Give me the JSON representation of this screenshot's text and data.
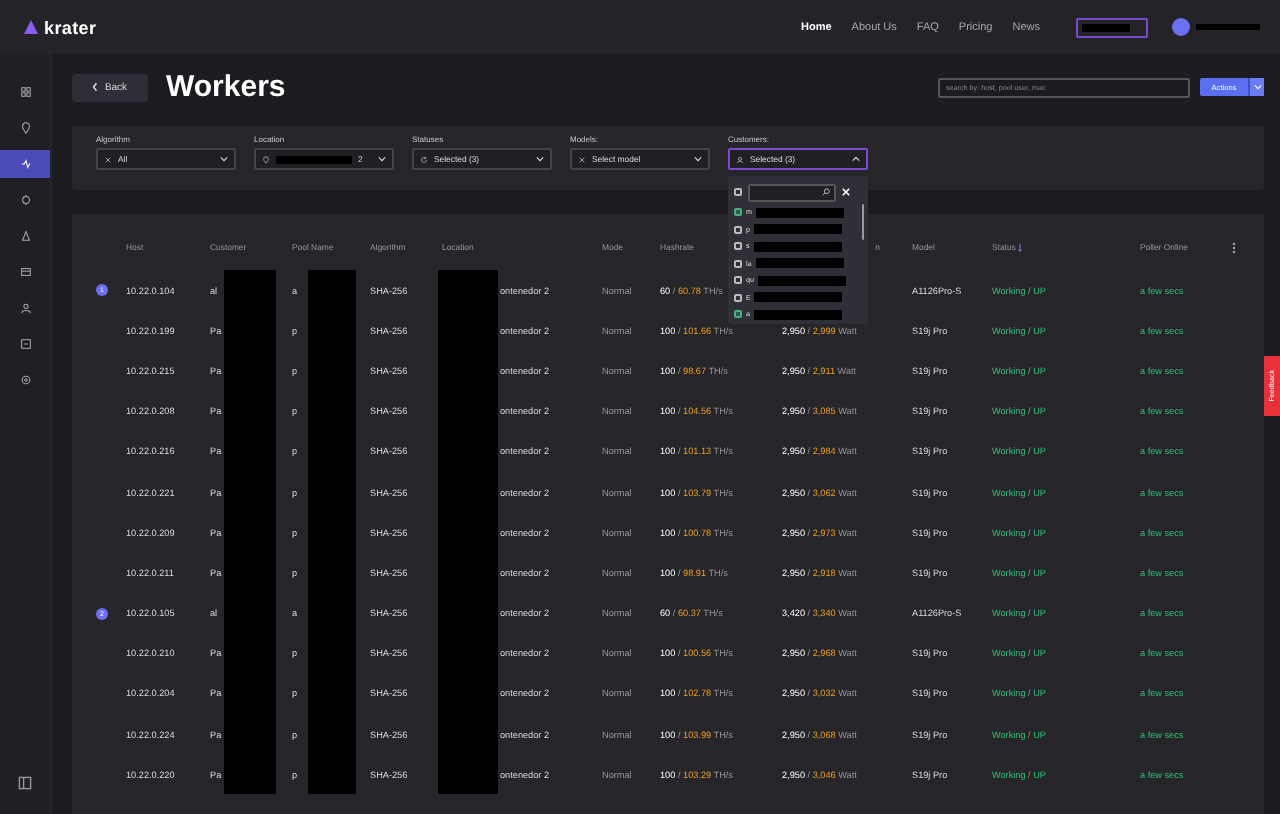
{
  "brand": {
    "name": "krater"
  },
  "nav": {
    "links": [
      {
        "label": "Home",
        "selected": true
      },
      {
        "label": "About Us",
        "selected": false
      },
      {
        "label": "FAQ",
        "selected": false
      },
      {
        "label": "Pricing",
        "selected": false
      },
      {
        "label": "News",
        "selected": false
      }
    ]
  },
  "sidebar": {
    "items": [
      {
        "selected": false
      },
      {
        "selected": false
      },
      {
        "selected": true
      },
      {
        "selected": false
      },
      {
        "selected": false
      },
      {
        "selected": false
      },
      {
        "selected": false
      },
      {
        "selected": false
      },
      {
        "selected": false
      }
    ]
  },
  "header": {
    "back": "Back",
    "title": "Workers",
    "search": {
      "placeholder": "search by: host, pool user, mac"
    },
    "actions": "Actions"
  },
  "filters": [
    {
      "label": "Algorithm",
      "value": "All",
      "expanded": false
    },
    {
      "label": "Location",
      "value": "2",
      "expanded": false
    },
    {
      "label": "Statuses",
      "value": "Selected (3)",
      "expanded": false
    },
    {
      "label": "Models:",
      "value": "Select model",
      "expanded": false
    },
    {
      "label": "Customers:",
      "value": "Selected (3)",
      "expanded": true
    }
  ],
  "customer_dropdown": {
    "select_all": {
      "checked": false
    },
    "items": [
      {
        "label": "m",
        "checked": true
      },
      {
        "label": "p",
        "checked": false
      },
      {
        "label": "s",
        "checked": false
      },
      {
        "label": "la",
        "checked": false
      },
      {
        "label": "qu",
        "checked": false
      },
      {
        "label": "E",
        "checked": false
      },
      {
        "label": "a",
        "checked": true
      }
    ]
  },
  "table": {
    "columns": [
      "Host",
      "Customer",
      "Pool Name",
      "Algorithm",
      "Location",
      "Mode",
      "Hashrate",
      "n",
      "Model",
      "Status",
      "Poller Online"
    ],
    "rows": [
      {
        "badge": "1",
        "host": "10.22.0.104",
        "customer": "al",
        "pool": "a",
        "algorithm": "SHA-256",
        "location": "ontenedor 2",
        "mode": "Normal",
        "hash_target": "60",
        "hash_sep": "/",
        "hash_actual": "60.78",
        "hash_unit": "TH/s",
        "model": "A1126Pro-S",
        "status": "Working",
        "status_sep": "/",
        "state": "UP",
        "poller": "a few secs"
      },
      {
        "host": "10.22.0.199",
        "customer": "Pa",
        "pool": "p",
        "algorithm": "SHA-256",
        "location": "ontenedor 2",
        "mode": "Normal",
        "hash_target": "100",
        "hash_sep": "/",
        "hash_actual": "101.66",
        "hash_unit": "TH/s",
        "power_target": "2,950",
        "power_sep": "/",
        "power_actual": "2,999",
        "power_unit": "Watt",
        "model": "S19j Pro",
        "status": "Working",
        "status_sep": "/",
        "state": "UP",
        "poller": "a few secs"
      },
      {
        "host": "10.22.0.215",
        "customer": "Pa",
        "pool": "p",
        "algorithm": "SHA-256",
        "location": "ontenedor 2",
        "mode": "Normal",
        "hash_target": "100",
        "hash_sep": "/",
        "hash_actual": "98.67",
        "hash_unit": "TH/s",
        "power_target": "2,950",
        "power_sep": "/",
        "power_actual": "2,911",
        "power_unit": "Watt",
        "model": "S19j Pro",
        "status": "Working",
        "status_sep": "/",
        "state": "UP",
        "poller": "a few secs"
      },
      {
        "host": "10.22.0.208",
        "customer": "Pa",
        "pool": "p",
        "algorithm": "SHA-256",
        "location": "ontenedor 2",
        "mode": "Normal",
        "hash_target": "100",
        "hash_sep": "/",
        "hash_actual": "104.56",
        "hash_unit": "TH/s",
        "power_target": "2,950",
        "power_sep": "/",
        "power_actual": "3,085",
        "power_unit": "Watt",
        "model": "S19j Pro",
        "status": "Working",
        "status_sep": "/",
        "state": "UP",
        "poller": "a few secs"
      },
      {
        "host": "10.22.0.216",
        "customer": "Pa",
        "pool": "p",
        "algorithm": "SHA-256",
        "location": "ontenedor 2",
        "mode": "Normal",
        "hash_target": "100",
        "hash_sep": "/",
        "hash_actual": "101.13",
        "hash_unit": "TH/s",
        "power_target": "2,950",
        "power_sep": "/",
        "power_actual": "2,984",
        "power_unit": "Watt",
        "model": "S19j Pro",
        "status": "Working",
        "status_sep": "/",
        "state": "UP",
        "poller": "a few secs"
      },
      {
        "host": "10.22.0.221",
        "customer": "Pa",
        "pool": "p",
        "algorithm": "SHA-256",
        "location": "ontenedor 2",
        "mode": "Normal",
        "hash_target": "100",
        "hash_sep": "/",
        "hash_actual": "103.79",
        "hash_unit": "TH/s",
        "power_target": "2,950",
        "power_sep": "/",
        "power_actual": "3,062",
        "power_unit": "Watt",
        "model": "S19j Pro",
        "status": "Working",
        "status_sep": "/",
        "state": "UP",
        "poller": "a few secs"
      },
      {
        "host": "10.22.0.209",
        "customer": "Pa",
        "pool": "p",
        "algorithm": "SHA-256",
        "location": "ontenedor 2",
        "mode": "Normal",
        "hash_target": "100",
        "hash_sep": "/",
        "hash_actual": "100.78",
        "hash_unit": "TH/s",
        "power_target": "2,950",
        "power_sep": "/",
        "power_actual": "2,973",
        "power_unit": "Watt",
        "model": "S19j Pro",
        "status": "Working",
        "status_sep": "/",
        "state": "UP",
        "poller": "a few secs"
      },
      {
        "host": "10.22.0.211",
        "customer": "Pa",
        "pool": "p",
        "algorithm": "SHA-256",
        "location": "ontenedor 2",
        "mode": "Normal",
        "hash_target": "100",
        "hash_sep": "/",
        "hash_actual": "98.91",
        "hash_unit": "TH/s",
        "power_target": "2,950",
        "power_sep": "/",
        "power_actual": "2,918",
        "power_unit": "Watt",
        "model": "S19j Pro",
        "status": "Working",
        "status_sep": "/",
        "state": "UP",
        "poller": "a few secs"
      },
      {
        "badge": "2",
        "host": "10.22.0.105",
        "customer": "al",
        "pool": "a",
        "algorithm": "SHA-256",
        "location": "ontenedor 2",
        "mode": "Normal",
        "hash_target": "60",
        "hash_sep": "/",
        "hash_actual": "60.37",
        "hash_unit": "TH/s",
        "power_target": "3,420",
        "power_sep": "/",
        "power_actual": "3,340",
        "power_unit": "Watt",
        "model": "A1126Pro-S",
        "status": "Working",
        "status_sep": "/",
        "state": "UP",
        "poller": "a few secs"
      },
      {
        "host": "10.22.0.210",
        "customer": "Pa",
        "pool": "p",
        "algorithm": "SHA-256",
        "location": "ontenedor 2",
        "mode": "Normal",
        "hash_target": "100",
        "hash_sep": "/",
        "hash_actual": "100.56",
        "hash_unit": "TH/s",
        "power_target": "2,950",
        "power_sep": "/",
        "power_actual": "2,968",
        "power_unit": "Watt",
        "model": "S19j Pro",
        "status": "Working",
        "status_sep": "/",
        "state": "UP",
        "poller": "a few secs"
      },
      {
        "host": "10.22.0.204",
        "customer": "Pa",
        "pool": "p",
        "algorithm": "SHA-256",
        "location": "ontenedor 2",
        "mode": "Normal",
        "hash_target": "100",
        "hash_sep": "/",
        "hash_actual": "102.78",
        "hash_unit": "TH/s",
        "power_target": "2,950",
        "power_sep": "/",
        "power_actual": "3,032",
        "power_unit": "Watt",
        "model": "S19j Pro",
        "status": "Working",
        "status_sep": "/",
        "state": "UP",
        "poller": "a few secs"
      },
      {
        "host": "10.22.0.224",
        "customer": "Pa",
        "pool": "p",
        "algorithm": "SHA-256",
        "location": "ontenedor 2",
        "mode": "Normal",
        "hash_target": "100",
        "hash_sep": "/",
        "hash_actual": "103.99",
        "hash_unit": "TH/s",
        "power_target": "2,950",
        "power_sep": "/",
        "power_actual": "3,068",
        "power_unit": "Watt",
        "model": "S19j Pro",
        "status": "Working",
        "status_sep": "/",
        "state": "UP",
        "poller": "a few secs"
      },
      {
        "host": "10.22.0.220",
        "customer": "Pa",
        "pool": "p",
        "algorithm": "SHA-256",
        "location": "ontenedor 2",
        "mode": "Normal",
        "hash_target": "100",
        "hash_sep": "/",
        "hash_actual": "103.29",
        "hash_unit": "TH/s",
        "power_target": "2,950",
        "power_sep": "/",
        "power_actual": "3,046",
        "power_unit": "Watt",
        "model": "S19j Pro",
        "status": "Working",
        "status_sep": "/",
        "state": "UP",
        "poller": "a few secs"
      }
    ]
  },
  "feedback_tab": {
    "label": "Feedback"
  }
}
